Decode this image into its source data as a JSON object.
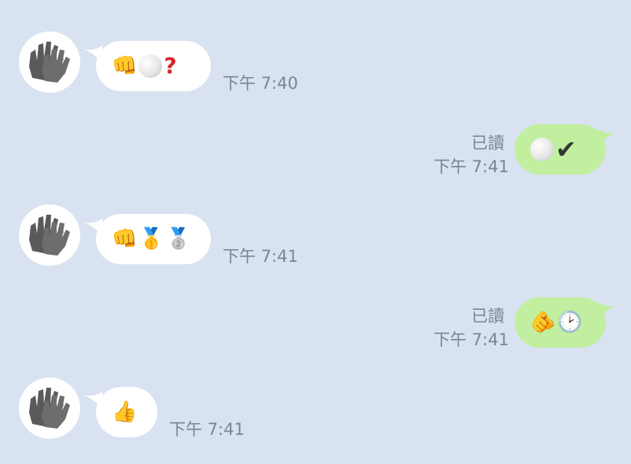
{
  "messages": [
    {
      "side": "in",
      "content": "👊⚪❓",
      "time": "下午 7:40"
    },
    {
      "side": "out",
      "content": "⚪✔",
      "read": "已讀",
      "time": "下午 7:41"
    },
    {
      "side": "in",
      "content": "👊🥇🥈",
      "time": "下午 7:41"
    },
    {
      "side": "out",
      "content": "🫵🕑",
      "read": "已讀",
      "time": "下午 7:41"
    },
    {
      "side": "in",
      "content": "👍",
      "time": "下午 7:41"
    }
  ],
  "icons": {
    "avatar": "gloves-icon",
    "fist": "fist-icon",
    "pearl": "white-circle-icon",
    "question": "question-mark-icon",
    "check": "check-mark-icon",
    "gold-medal": "gold-medal-icon",
    "silver-medal": "silver-medal-icon",
    "pointing": "pointing-finger-icon",
    "clock": "clock-icon",
    "thumbs-up": "thumbs-up-icon"
  },
  "colors": {
    "background": "#d8e2f0",
    "incoming_bubble": "#ffffff",
    "outgoing_bubble": "#c2ef9f",
    "timestamp": "#7c8591"
  }
}
